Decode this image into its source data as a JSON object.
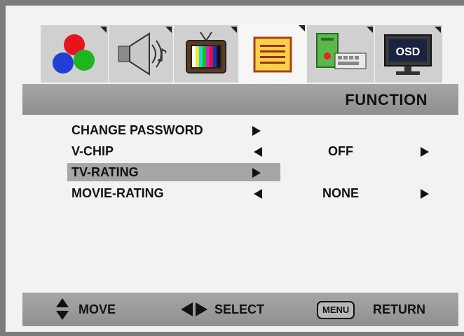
{
  "menu": {
    "header_title": "FUNCTION",
    "tabs": [
      {
        "name": "picture",
        "icon": "rgb-circles-icon"
      },
      {
        "name": "audio",
        "icon": "speaker-icon"
      },
      {
        "name": "tv",
        "icon": "television-icon"
      },
      {
        "name": "function",
        "icon": "function-list-icon",
        "active": true
      },
      {
        "name": "setup",
        "icon": "computer-icon"
      },
      {
        "name": "osd",
        "icon": "osd-monitor-icon",
        "label": "OSD"
      }
    ],
    "items": [
      {
        "label": "CHANGE PASSWORD",
        "value": ""
      },
      {
        "label": "V-CHIP",
        "value": "OFF"
      },
      {
        "label": "TV-RATING",
        "value": "",
        "selected": true
      },
      {
        "label": "MOVIE-RATING",
        "value": "NONE"
      }
    ]
  },
  "footer": {
    "move_label": "MOVE",
    "select_label": "SELECT",
    "menu_key": "MENU",
    "return_label": "RETURN"
  },
  "colors": {
    "background": "#f2f2f2",
    "bar": "#a0a0a0",
    "highlight": "#a6a6a6",
    "frame": "#7c7c7c"
  }
}
